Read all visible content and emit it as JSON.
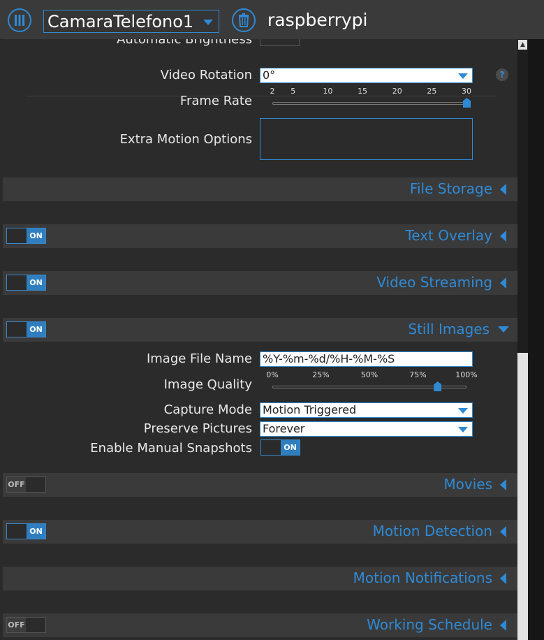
{
  "header": {
    "camera": "CamaraTelefono1",
    "host": "raspberrypi"
  },
  "partial_row": {
    "label": "Automatic Brightness",
    "toggle": "ON"
  },
  "video_device": {
    "rotation_label": "Video Rotation",
    "rotation_value": "0°",
    "framerate_label": "Frame Rate",
    "framerate_ticks": [
      "2",
      "5",
      "10",
      "15",
      "20",
      "25",
      "30"
    ],
    "framerate_value": 30,
    "extra_label": "Extra Motion Options",
    "extra_value": "",
    "help": "?"
  },
  "sections": {
    "file_storage": "File Storage",
    "text_overlay": {
      "title": "Text Overlay",
      "toggle": "ON"
    },
    "video_streaming": {
      "title": "Video Streaming",
      "toggle": "ON"
    },
    "still_images": {
      "title": "Still Images",
      "toggle": "ON"
    },
    "movies": {
      "title": "Movies",
      "toggle": "OFF"
    },
    "motion_detection": {
      "title": "Motion Detection",
      "toggle": "ON"
    },
    "motion_notifications": "Motion Notifications",
    "working_schedule": {
      "title": "Working Schedule",
      "toggle": "OFF"
    }
  },
  "still_images": {
    "filename_label": "Image File Name",
    "filename_value": "%Y-%m-%d/%H-%M-%S",
    "quality_label": "Image Quality",
    "quality_ticks": [
      "0%",
      "25%",
      "50%",
      "75%",
      "100%"
    ],
    "quality_value": 85,
    "capture_label": "Capture Mode",
    "capture_value": "Motion Triggered",
    "preserve_label": "Preserve Pictures",
    "preserve_value": "Forever",
    "snapshots_label": "Enable Manual Snapshots",
    "snapshots_toggle": "ON"
  },
  "colors": {
    "accent": "#2f8ad6",
    "background": "#2b2b2b",
    "bar": "#3a3a3a"
  }
}
